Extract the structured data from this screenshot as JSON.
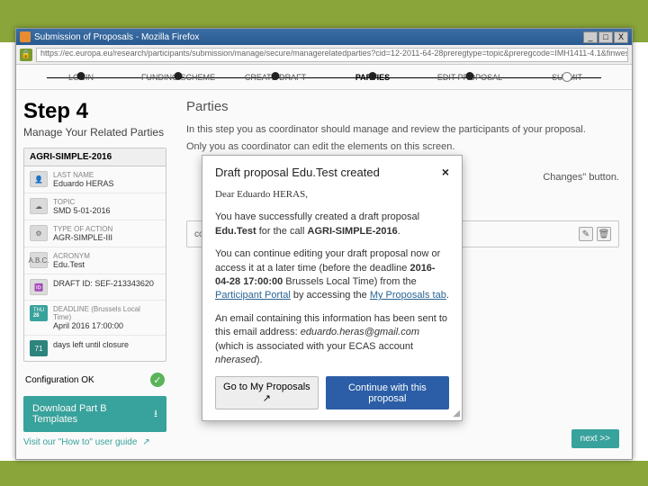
{
  "window": {
    "title": "Submission of Proposals - Mozilla Firefox",
    "minimize": "_",
    "maximize": "□",
    "close": "X"
  },
  "url": "https://ec.europa.eu/research/participants/submission/manage/secure/managerelatedparties?cid=12-2011-64-28preregtype=topic&preregcode=IMH1411-4.1&finwest=call-4-AGR12",
  "stepper": {
    "s1": "LOGIN",
    "s2": "FUNDING SCHEME",
    "s3": "CREATE DRAFT",
    "s4": "PARTIES",
    "s5": "EDIT PROPOSAL",
    "s6": "SUBMIT"
  },
  "left": {
    "step_label": "Step 4",
    "step_sub": "Manage Your Related Parties",
    "call_code": "AGRI-SIMPLE-2016",
    "rows": {
      "user_lbl": "LAST NAME",
      "user_val": "Eduardo HERAS",
      "topic_lbl": "TOPIC",
      "topic_val": "SMD 5-01-2016",
      "toa_lbl": "TYPE OF ACTION",
      "toa_val": "AGR-SIMPLE-III",
      "acr_ic": "A.B.C.",
      "acr_lbl": "ACRONYM",
      "acr_val": "Edu.Test",
      "did_lbl": "DRAFT ID: SEF-213343620",
      "dl_ic": "THU",
      "dl_day": "28",
      "dl_lbl": "DEADLINE (Brussels Local Time)",
      "dl_val": "April 2016 17:00:00",
      "left_ic": "71",
      "left_val": "days left until closure"
    },
    "config": "Configuration OK",
    "dl_btn": "Download Part B Templates",
    "guide": "Visit our \"How to\" user guide"
  },
  "right": {
    "title": "Parties",
    "desc1": "In this step you as coordinator should manage and review the participants of your proposal.",
    "desc2": "Only you as coordinator can edit the elements on this screen.",
    "desc3": "Changes\" button.",
    "contact": "contact",
    "next": "next >>"
  },
  "modal": {
    "title": "Draft proposal Edu.Test created",
    "close": "×",
    "p1a": "Dear Eduardo HERAS,",
    "p1b_a": "You have successfully created a draft proposal ",
    "p1b_b": "Edu.Test",
    "p1b_c": " for the call ",
    "p1b_d": "AGRI-SIMPLE-2016",
    "p1b_e": ".",
    "p2a": "You can continue editing your draft proposal now or access it at a later time (before the deadline ",
    "p2b": "2016-04-28 17:00:00",
    "p2c": " Brussels Local Time) from the ",
    "p2d": "Participant Portal",
    "p2e": " by accessing the ",
    "p2f": "My Proposals tab",
    "p2g": ".",
    "p3a": "An email containing this information has been sent to this email address: ",
    "p3b": "eduardo.heras@gmail.com",
    "p3c": " (which is associated with your ECAS account ",
    "p3d": "nherased",
    "p3e": ").",
    "btn1": "Go to My Proposals ↗",
    "btn2": "Continue with this proposal"
  }
}
